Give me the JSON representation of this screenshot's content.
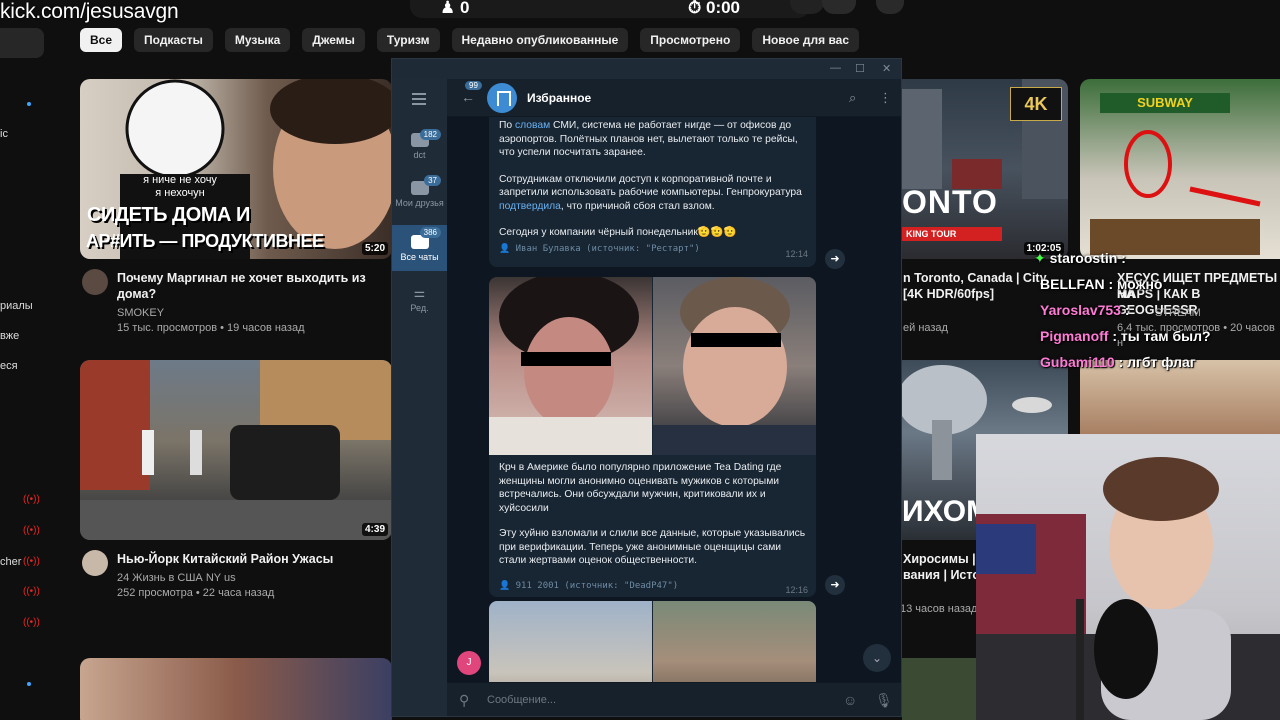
{
  "overlay": {
    "watermark": "kick.com/jesusavgn"
  },
  "top": {
    "counter_left": "0",
    "timer": "0:00"
  },
  "chips": [
    {
      "label": "Все",
      "active": true
    },
    {
      "label": "Подкасты"
    },
    {
      "label": "Музыка"
    },
    {
      "label": "Джемы"
    },
    {
      "label": "Туризм"
    },
    {
      "label": "Недавно опубликованные"
    },
    {
      "label": "Просмотрено"
    },
    {
      "label": "Новое для вас"
    }
  ],
  "leftnav": {
    "items": [
      "ic",
      "риалы",
      "вже",
      "еся",
      "cher"
    ]
  },
  "videos": [
    {
      "title": "Почему Маргинал не хочет выходить из дома?",
      "channel": "SMOKEY",
      "meta": "15 тыс. просмотров • 19 часов назад",
      "duration": "5:20",
      "thumb_text": [
        "я ниче не хочу",
        "я нехочун",
        "СИДЕТЬ ДОМА И",
        "АР#ИТЬ — ПРОДУКТИВНЕЕ"
      ]
    },
    {
      "title": "Нью-Йорк Китайский Район Ужасы",
      "channel": "24 Жизнь в США NY us",
      "meta": "252 просмотра • 22 часа назад",
      "duration": "4:39"
    },
    {
      "title": "n Toronto, Canada | City",
      "title2": "[4K HDR/60fps]",
      "meta": "ей назад",
      "duration": "1:02:05",
      "thumb_text": [
        "ONTO",
        "KING TOUR",
        "4K"
      ]
    },
    {
      "title": "ХЕСУС ИЩЕТ ПРЕДМЕТЫ НА",
      "title2": "MAPS | КАК В GEOGUESSR",
      "channel": "STREAM",
      "meta": "6,4 тыс. просмотров • 20 часов н",
      "thumb_text": [
        "SUBWAY"
      ]
    },
    {
      "title": "Хиросимы |",
      "title2": "вания | Истори",
      "meta": "13 часов назад",
      "thumb_text": [
        "ИХОМ С"
      ]
    }
  ],
  "telegram": {
    "chat_name": "Избранное",
    "back_badge": "99",
    "search_icon": "search-icon",
    "folders": [
      {
        "label": "dct",
        "badge": "182"
      },
      {
        "label": "Мои друзья",
        "badge": "37"
      },
      {
        "label": "Все чаты",
        "badge": "386",
        "active": true
      },
      {
        "label": "Ред."
      }
    ],
    "msg1": {
      "p1_a": "По ",
      "p1_link": "словам",
      "p1_b": " СМИ, система не работает нигде — от офисов до аэропортов. Полётных планов нет, вылетают только те рейсы, что успели посчитать заранее.",
      "p2_a": "Сотрудникам отключили доступ к корпоративной почте и запретили использовать рабочие компьютеры. Генпрокуратура ",
      "p2_link": "подтвердила",
      "p2_b": ", что причиной сбоя стал взлом.",
      "p3": "Сегодня у компании чёрный понедельник🫡🫡🫡",
      "source": "Иван Булавка (источник: \"Рестарт\")",
      "time": "12:14"
    },
    "msg2": {
      "p1": "Крч в Америке было популярно приложение Tea Dating где женщины могли анонимно оценивать мужиков с которыми встречались. Они обсуждали мужчин, критиковали их и хуйсосили",
      "p2": "Эту хуйню взломали и слили все данные, которые указывались при верификации. Теперь уже анонимные оценщицы сами стали жертвами оценок общественности.",
      "source": "911 2001 (источник: \"DeadP47\")",
      "time": "12:16"
    },
    "input_placeholder": "Сообщение...",
    "user_initial": "J"
  },
  "stream_chat": [
    {
      "user": "staroostin",
      "text": " : ",
      "color": "#ffffff"
    },
    {
      "user": "BELLFAN",
      "text": " : можно",
      "color": "#ffffff"
    },
    {
      "user": "Yaroslav753",
      "text": " : ",
      "color": "#ff7bd5"
    },
    {
      "user": "Pigmanoff",
      "text": " : ты там был?",
      "color": "#ff7bd5"
    },
    {
      "user": "Gubami110",
      "text": " : лгбт флаг",
      "color": "#ff7bd5"
    }
  ]
}
